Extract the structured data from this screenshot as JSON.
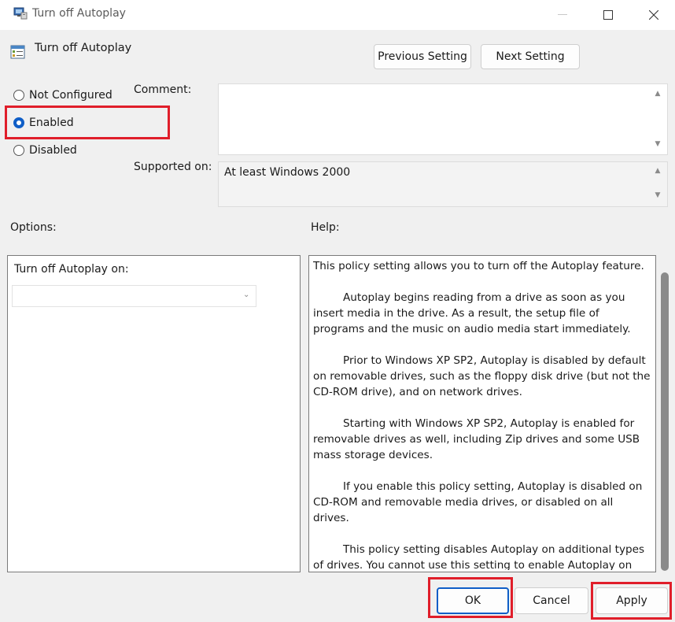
{
  "window": {
    "title": "Turn off Autoplay",
    "controls": [
      "minimize-icon",
      "maximize-icon",
      "close-icon"
    ]
  },
  "header": {
    "setting_name": "Turn off Autoplay",
    "previous_label": "Previous Setting",
    "next_label": "Next Setting"
  },
  "state": {
    "options": [
      {
        "label": "Not Configured",
        "checked": false
      },
      {
        "label": "Enabled",
        "checked": true
      },
      {
        "label": "Disabled",
        "checked": false
      }
    ]
  },
  "comment": {
    "label": "Comment:",
    "value": ""
  },
  "supported": {
    "label": "Supported on:",
    "value": "At least Windows 2000"
  },
  "options_panel": {
    "label": "Options:",
    "autoplay_on_label": "Turn off Autoplay on:",
    "autoplay_on_value": ""
  },
  "help": {
    "label": "Help:",
    "paragraphs": [
      "This policy setting allows you to turn off the Autoplay feature.",
      "Autoplay begins reading from a drive as soon as you insert media in the drive. As a result, the setup file of programs and the music on audio media start immediately.",
      "Prior to Windows XP SP2, Autoplay is disabled by default on removable drives, such as the floppy disk drive (but not the CD-ROM drive), and on network drives.",
      "Starting with Windows XP SP2, Autoplay is enabled for removable drives as well, including Zip drives and some USB mass storage devices.",
      "If you enable this policy setting, Autoplay is disabled on CD-ROM and removable media drives, or disabled on all drives.",
      "This policy setting disables Autoplay on additional types of drives. You cannot use this setting to enable Autoplay on drives on which it is disabled by default."
    ]
  },
  "footer": {
    "ok_label": "OK",
    "cancel_label": "Cancel",
    "apply_label": "Apply"
  },
  "colors": {
    "accent": "#0f5ec7",
    "highlight": "#e01e2a"
  }
}
